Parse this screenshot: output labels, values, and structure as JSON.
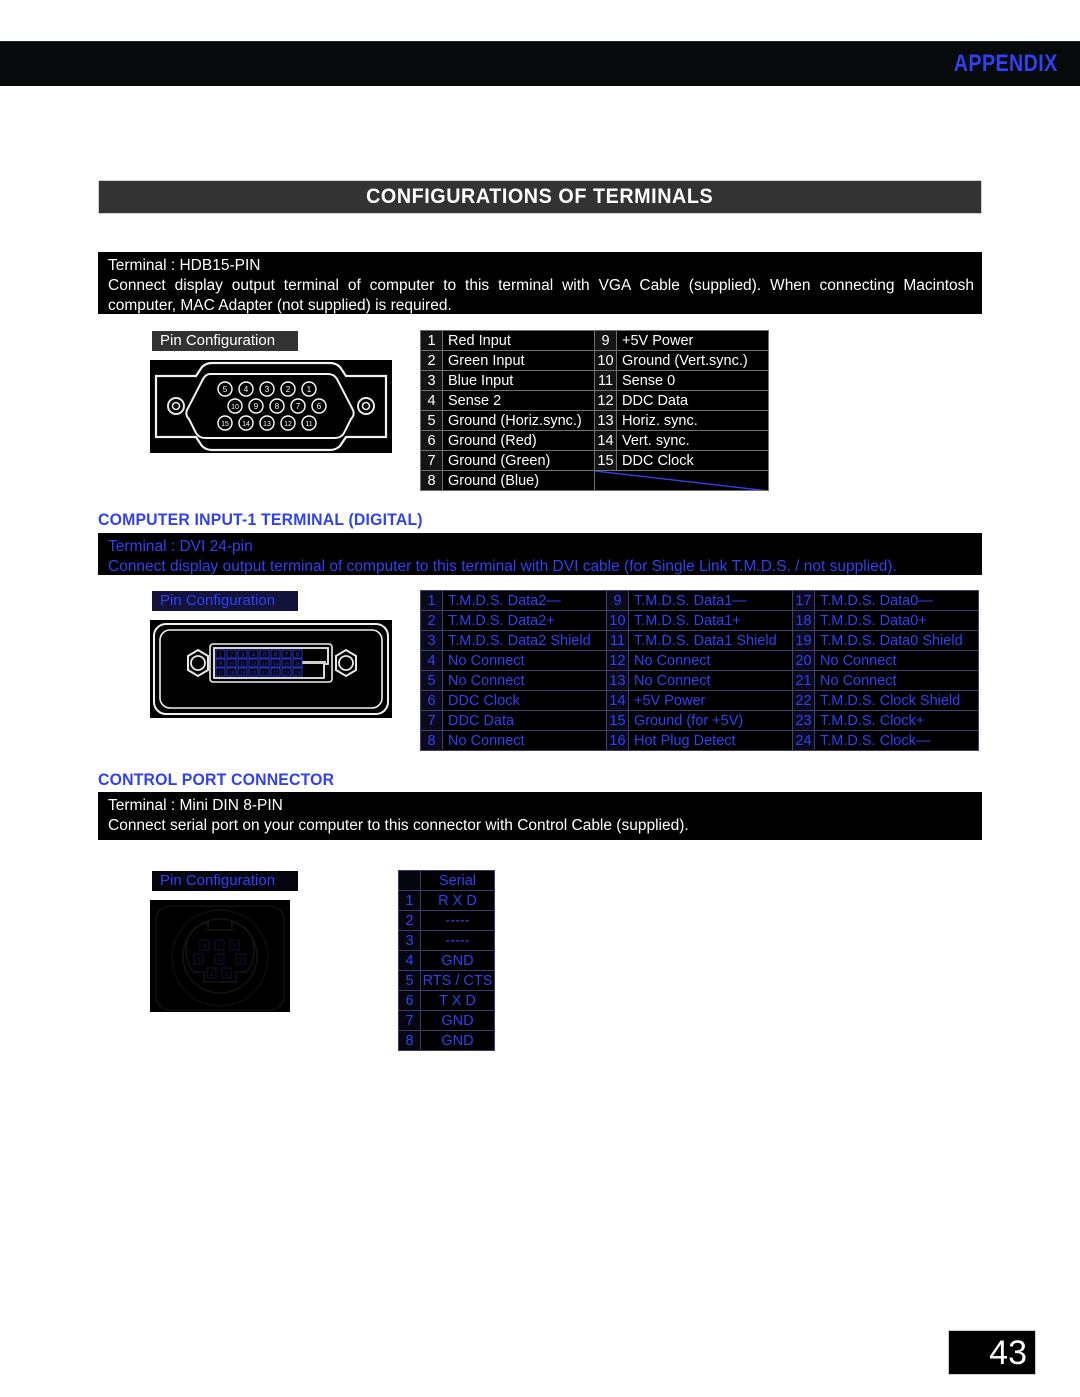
{
  "header": {
    "appendix_label": "APPENDIX"
  },
  "title_banner": {
    "text": "CONFIGURATIONS OF TERMINALS"
  },
  "page_number": "43",
  "sections": {
    "vga": {
      "terminal_line": "Terminal : HDB15-PIN",
      "description": "Connect display output terminal of computer to this terminal with VGA Cable (supplied). When connecting Macintosh computer, MAC Adapter (not supplied) is required.",
      "pin_config_label": "Pin Configuration",
      "connector_pins": {
        "row_top": [
          "5",
          "4",
          "3",
          "2",
          "1"
        ],
        "row_mid": [
          "10",
          "9",
          "8",
          "7",
          "6"
        ],
        "row_bot": [
          "15",
          "14",
          "13",
          "12",
          "11"
        ]
      },
      "table": {
        "left_column": [
          {
            "pin": "1",
            "signal": "Red Input"
          },
          {
            "pin": "2",
            "signal": "Green Input"
          },
          {
            "pin": "3",
            "signal": "Blue Input"
          },
          {
            "pin": "4",
            "signal": "Sense 2"
          },
          {
            "pin": "5",
            "signal": "Ground (Horiz.sync.)"
          },
          {
            "pin": "6",
            "signal": "Ground (Red)"
          },
          {
            "pin": "7",
            "signal": "Ground (Green)"
          },
          {
            "pin": "8",
            "signal": "Ground (Blue)"
          }
        ],
        "right_column": [
          {
            "pin": "9",
            "signal": "+5V Power"
          },
          {
            "pin": "10",
            "signal": "Ground (Vert.sync.)"
          },
          {
            "pin": "11",
            "signal": "Sense 0"
          },
          {
            "pin": "12",
            "signal": "DDC Data"
          },
          {
            "pin": "13",
            "signal": "Horiz. sync."
          },
          {
            "pin": "14",
            "signal": "Vert. sync."
          },
          {
            "pin": "15",
            "signal": "DDC Clock"
          },
          {
            "pin": "",
            "signal": ""
          }
        ]
      }
    },
    "dvi": {
      "heading": "COMPUTER INPUT-1 TERMINAL (DIGITAL)",
      "terminal_line": "Terminal : DVI 24-pin",
      "description": "Connect display output terminal of computer to this terminal with DVI cable (for Single Link T.M.D.S. / not supplied).",
      "pin_config_label": "Pin Configuration",
      "connector_pins": {
        "row_top": [
          "1",
          "2",
          "3",
          "4",
          "5",
          "6",
          "7",
          "8"
        ],
        "row_mid": [
          "9",
          "10",
          "11",
          "12",
          "13",
          "14",
          "15",
          "16"
        ],
        "row_bot": [
          "17",
          "18",
          "19",
          "20",
          "21",
          "22",
          "23",
          "24"
        ]
      },
      "table": {
        "col1": [
          {
            "pin": "1",
            "signal": "T.M.D.S. Data2—"
          },
          {
            "pin": "2",
            "signal": "T.M.D.S. Data2+"
          },
          {
            "pin": "3",
            "signal": "T.M.D.S. Data2 Shield"
          },
          {
            "pin": "4",
            "signal": "No Connect"
          },
          {
            "pin": "5",
            "signal": "No Connect"
          },
          {
            "pin": "6",
            "signal": "DDC Clock"
          },
          {
            "pin": "7",
            "signal": "DDC Data"
          },
          {
            "pin": "8",
            "signal": "No Connect"
          }
        ],
        "col2": [
          {
            "pin": "9",
            "signal": "T.M.D.S. Data1—"
          },
          {
            "pin": "10",
            "signal": "T.M.D.S. Data1+"
          },
          {
            "pin": "11",
            "signal": "T.M.D.S. Data1 Shield"
          },
          {
            "pin": "12",
            "signal": "No Connect"
          },
          {
            "pin": "13",
            "signal": "No Connect"
          },
          {
            "pin": "14",
            "signal": "+5V Power"
          },
          {
            "pin": "15",
            "signal": "Ground (for +5V)"
          },
          {
            "pin": "16",
            "signal": "Hot Plug Detect"
          }
        ],
        "col3": [
          {
            "pin": "17",
            "signal": "T.M.D.S. Data0—"
          },
          {
            "pin": "18",
            "signal": "T.M.D.S. Data0+"
          },
          {
            "pin": "19",
            "signal": "T.M.D.S. Data0 Shield"
          },
          {
            "pin": "20",
            "signal": "No Connect"
          },
          {
            "pin": "21",
            "signal": "No Connect"
          },
          {
            "pin": "22",
            "signal": "T.M.D.S. Clock Shield"
          },
          {
            "pin": "23",
            "signal": "T.M.D.S. Clock+"
          },
          {
            "pin": "24",
            "signal": "T.M.D.S. Clock—"
          }
        ]
      }
    },
    "control": {
      "heading": "CONTROL PORT CONNECTOR",
      "terminal_line": "Terminal : Mini DIN 8-PIN",
      "description": "Connect serial port on your computer to this connector with Control Cable (supplied).",
      "pin_config_label": "Pin Configuration",
      "connector_pins": {
        "row_top": [
          "8",
          "7",
          "6"
        ],
        "row_mid": [
          "5",
          "4",
          "3"
        ],
        "row_bot": [
          "2",
          "1"
        ]
      },
      "table": {
        "header": "Serial",
        "rows": [
          {
            "pin": "1",
            "signal": "R X D"
          },
          {
            "pin": "2",
            "signal": "-----"
          },
          {
            "pin": "3",
            "signal": "-----"
          },
          {
            "pin": "4",
            "signal": "GND"
          },
          {
            "pin": "5",
            "signal": "RTS / CTS"
          },
          {
            "pin": "6",
            "signal": "T X D"
          },
          {
            "pin": "7",
            "signal": "GND"
          },
          {
            "pin": "8",
            "signal": "GND"
          }
        ]
      }
    }
  },
  "colors": {
    "accent_blue": "#2f41f2",
    "banner_gray": "#333333",
    "black": "#000000",
    "white": "#ffffff"
  }
}
